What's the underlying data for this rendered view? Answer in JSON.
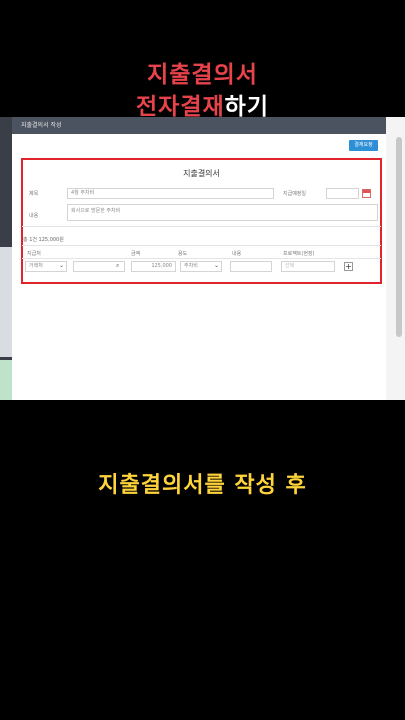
{
  "captions": {
    "line1": "지출결의서",
    "line2_red": "전자결재",
    "line2_white": "하기",
    "bottom": "지출결의서를 작성 후"
  },
  "modal": {
    "header_title": "지출결의서 작성",
    "pay_button": "결재요청",
    "form_title": "지출결의서"
  },
  "form": {
    "subject_label": "제목",
    "subject_value": "4월 주차비",
    "date_label": "지급예정일",
    "content_label": "내용",
    "content_value": "회사으로 방문한 주차비"
  },
  "table": {
    "summary": "총 1건 125,000원",
    "headers": [
      "지급처",
      "금액",
      "용도",
      "내용",
      "프로젝트(현장)"
    ],
    "row": {
      "payee": "거래처",
      "amount": "125,000",
      "purpose": "주차비",
      "content": "",
      "project": "선택"
    }
  },
  "colors": {
    "caption_red": "#e8434b",
    "caption_yellow": "#ffd43b",
    "highlight": "#e0242c",
    "button_blue": "#2d8fd6"
  }
}
